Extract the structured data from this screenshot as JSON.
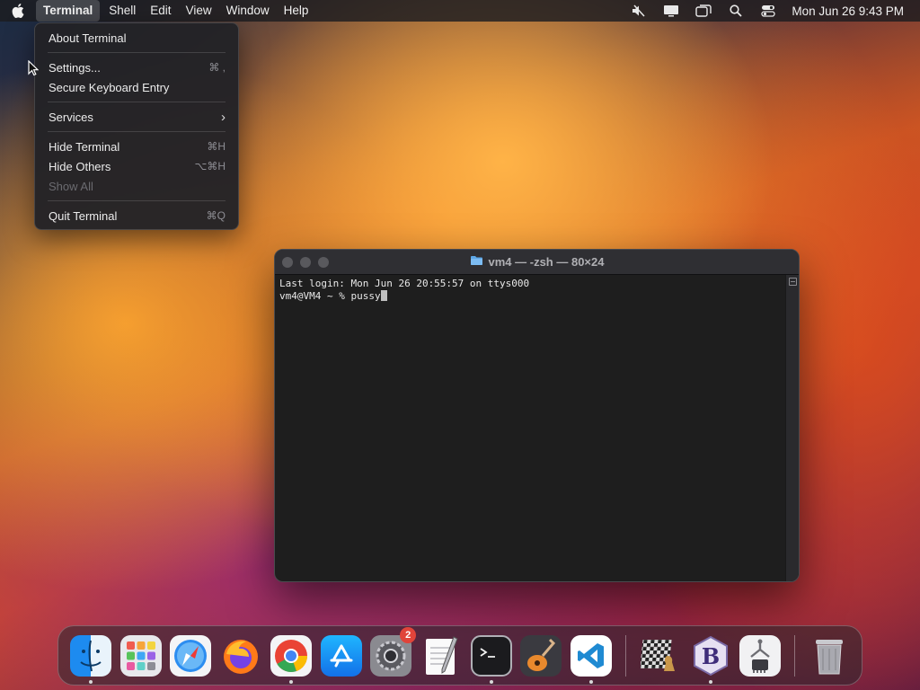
{
  "menubar": {
    "app_name": "Terminal",
    "menus": [
      "Shell",
      "Edit",
      "View",
      "Window",
      "Help"
    ],
    "status_icons": [
      "mute-icon",
      "display-icon",
      "screen-mirroring-icon",
      "spotlight-search-icon",
      "control-center-icon"
    ],
    "clock": "Mon Jun 26  9:43 PM"
  },
  "app_menu": {
    "items": [
      {
        "label": "About Terminal",
        "shortcut": ""
      },
      {
        "label": "Settings...",
        "shortcut": "⌘ ,"
      },
      {
        "label": "Secure Keyboard Entry",
        "shortcut": ""
      },
      {
        "label": "Services",
        "shortcut": "›"
      },
      {
        "label": "Hide Terminal",
        "shortcut": "⌘H"
      },
      {
        "label": "Hide Others",
        "shortcut": "⌥⌘H"
      },
      {
        "label": "Show All",
        "shortcut": "",
        "disabled": true
      },
      {
        "label": "Quit Terminal",
        "shortcut": "⌘Q"
      }
    ]
  },
  "terminal": {
    "title": "vm4 — -zsh — 80×24",
    "lines": [
      "Last login: Mon Jun 26 20:55:57 on ttys000",
      "vm4@VM4 ~ % pussy"
    ]
  },
  "dock": {
    "apps": [
      {
        "name": "Finder",
        "icon": "finder-icon",
        "running": true
      },
      {
        "name": "Launchpad",
        "icon": "launchpad-icon",
        "running": false
      },
      {
        "name": "Safari",
        "icon": "safari-icon",
        "running": false
      },
      {
        "name": "Firefox",
        "icon": "firefox-icon",
        "running": false
      },
      {
        "name": "Google Chrome",
        "icon": "chrome-icon",
        "running": true
      },
      {
        "name": "App Store",
        "icon": "app-store-icon",
        "running": false
      },
      {
        "name": "System Settings",
        "icon": "system-settings-icon",
        "running": false,
        "badge": "2"
      },
      {
        "name": "TextEdit",
        "icon": "textedit-icon",
        "running": false
      },
      {
        "name": "Terminal",
        "icon": "terminal-icon",
        "running": true
      },
      {
        "name": "GarageBand",
        "icon": "garageband-icon",
        "running": false
      },
      {
        "name": "Visual Studio Code",
        "icon": "vscode-icon",
        "running": true
      }
    ],
    "extra_apps": [
      {
        "name": "Chess",
        "icon": "chess-icon",
        "running": false
      },
      {
        "name": "BBEdit",
        "icon": "bbedit-icon",
        "running": true
      },
      {
        "name": "System Information",
        "icon": "system-information-icon",
        "running": false
      }
    ],
    "trash": {
      "name": "Trash",
      "icon": "trash-icon"
    }
  }
}
